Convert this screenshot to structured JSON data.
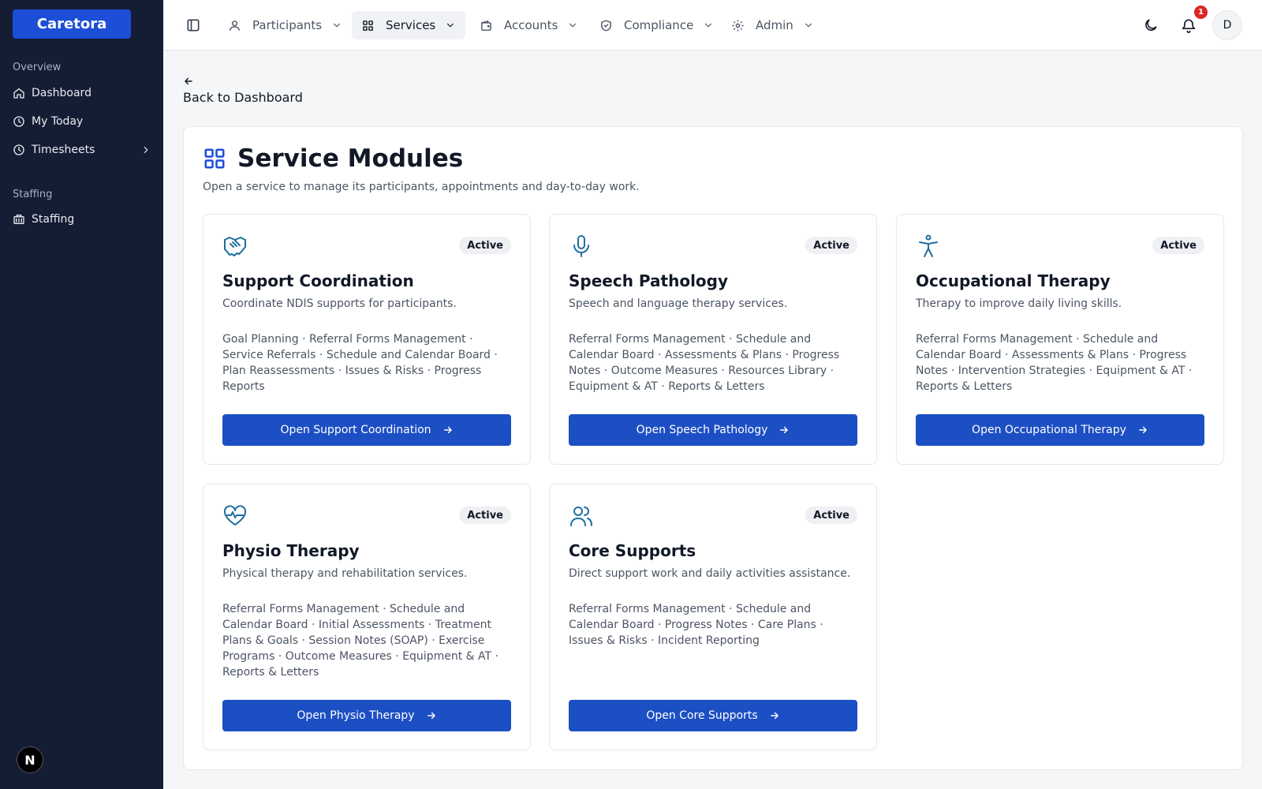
{
  "sidebar": {
    "brand": "Caretora",
    "sections": {
      "overview": "Overview",
      "staffing": "Staffing"
    },
    "items": {
      "dashboard": "Dashboard",
      "my_today": "My Today",
      "timesheets": "Timesheets",
      "staffing": "Staffing"
    },
    "corner_badge": "N"
  },
  "topnav": {
    "participants": "Participants",
    "services": "Services",
    "accounts": "Accounts",
    "compliance": "Compliance",
    "admin": "Admin",
    "notification_count": "1",
    "avatar_initial": "D"
  },
  "back_link": "Back to Dashboard",
  "page": {
    "title": "Service Modules",
    "subtitle": "Open a service to manage its participants, appointments and day-to-day work."
  },
  "cards": [
    {
      "icon": "handshake-icon",
      "badge": "Active",
      "title": "Support Coordination",
      "description": "Coordinate NDIS supports for participants.",
      "features": "Goal Planning · Referral Forms Management · Service Referrals · Schedule and Calendar Board · Plan Reassessments · Issues & Risks · Progress Reports",
      "button": "Open Support Coordination"
    },
    {
      "icon": "microphone-icon",
      "badge": "Active",
      "title": "Speech Pathology",
      "description": "Speech and language therapy services.",
      "features": "Referral Forms Management · Schedule and Calendar Board · Assessments & Plans · Progress Notes · Outcome Measures · Resources Library · Equipment & AT · Reports & Letters",
      "button": "Open Speech Pathology"
    },
    {
      "icon": "accessibility-icon",
      "badge": "Active",
      "title": "Occupational Therapy",
      "description": "Therapy to improve daily living skills.",
      "features": "Referral Forms Management · Schedule and Calendar Board · Assessments & Plans · Progress Notes · Intervention Strategies · Equipment & AT · Reports & Letters",
      "button": "Open Occupational Therapy"
    },
    {
      "icon": "heart-pulse-icon",
      "badge": "Active",
      "title": "Physio Therapy",
      "description": "Physical therapy and rehabilitation services.",
      "features": "Referral Forms Management · Schedule and Calendar Board · Initial Assessments · Treatment Plans & Goals · Session Notes (SOAP) · Exercise Programs · Outcome Measures · Equipment & AT · Reports & Letters",
      "button": "Open Physio Therapy"
    },
    {
      "icon": "users-icon",
      "badge": "Active",
      "title": "Core Supports",
      "description": "Direct support work and daily activities assistance.",
      "features": "Referral Forms Management · Schedule and Calendar Board · Progress Notes · Care Plans · Issues & Risks · Incident Reporting",
      "button": "Open Core Supports"
    }
  ],
  "colors": {
    "sidebar_bg": "#141d33",
    "brand_blue": "#1d4ed8",
    "button_blue": "#1d4fc4",
    "icon_teal": "#1f6f9f",
    "notification_red": "#dc2626"
  }
}
